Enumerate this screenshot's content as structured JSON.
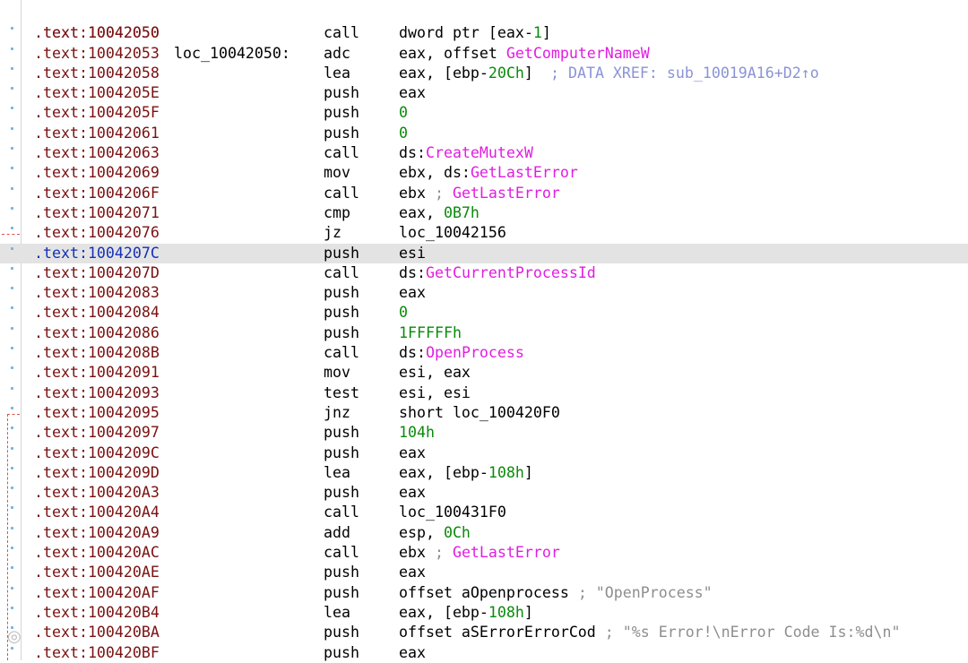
{
  "header": {
    "address": ".text:10042050",
    "label": "loc_10042050:",
    "xref": "; DATA XREF: sub_10019A16+D2↑o"
  },
  "rows": [
    {
      "address": ".text:10042050",
      "mnemonic": "call",
      "operands": [
        {
          "t": "dword ptr [eax-",
          "k": "plain"
        },
        {
          "t": "1",
          "k": "num"
        },
        {
          "t": "]",
          "k": "plain"
        }
      ]
    },
    {
      "address": ".text:10042053",
      "mnemonic": "adc",
      "operands": [
        {
          "t": "eax, offset ",
          "k": "plain"
        },
        {
          "t": "GetComputerNameW",
          "k": "api"
        }
      ]
    },
    {
      "address": ".text:10042058",
      "mnemonic": "lea",
      "operands": [
        {
          "t": "eax, [ebp-",
          "k": "plain"
        },
        {
          "t": "20Ch",
          "k": "num"
        },
        {
          "t": "]",
          "k": "plain"
        }
      ]
    },
    {
      "address": ".text:1004205E",
      "mnemonic": "push",
      "operands": [
        {
          "t": "eax",
          "k": "plain"
        }
      ]
    },
    {
      "address": ".text:1004205F",
      "mnemonic": "push",
      "operands": [
        {
          "t": "0",
          "k": "num"
        }
      ]
    },
    {
      "address": ".text:10042061",
      "mnemonic": "push",
      "operands": [
        {
          "t": "0",
          "k": "num"
        }
      ]
    },
    {
      "address": ".text:10042063",
      "mnemonic": "call",
      "operands": [
        {
          "t": "ds:",
          "k": "plain"
        },
        {
          "t": "CreateMutexW",
          "k": "api"
        }
      ]
    },
    {
      "address": ".text:10042069",
      "mnemonic": "mov",
      "operands": [
        {
          "t": "ebx, ds:",
          "k": "plain"
        },
        {
          "t": "GetLastError",
          "k": "api"
        }
      ]
    },
    {
      "address": ".text:1004206F",
      "mnemonic": "call",
      "operands": [
        {
          "t": "ebx ",
          "k": "plain"
        },
        {
          "t": "; ",
          "k": "comment"
        },
        {
          "t": "GetLastError",
          "k": "api"
        }
      ]
    },
    {
      "address": ".text:10042071",
      "mnemonic": "cmp",
      "operands": [
        {
          "t": "eax, ",
          "k": "plain"
        },
        {
          "t": "0B7h",
          "k": "num"
        }
      ]
    },
    {
      "address": ".text:10042076",
      "mnemonic": "jz",
      "operands": [
        {
          "t": "loc_10042156",
          "k": "plain"
        }
      ]
    },
    {
      "address": ".text:1004207C",
      "mnemonic": "push",
      "operands": [
        {
          "t": "esi",
          "k": "plain"
        }
      ],
      "highlight": true
    },
    {
      "address": ".text:1004207D",
      "mnemonic": "call",
      "operands": [
        {
          "t": "ds:",
          "k": "plain"
        },
        {
          "t": "GetCurrentProcessId",
          "k": "api"
        }
      ]
    },
    {
      "address": ".text:10042083",
      "mnemonic": "push",
      "operands": [
        {
          "t": "eax",
          "k": "plain"
        }
      ]
    },
    {
      "address": ".text:10042084",
      "mnemonic": "push",
      "operands": [
        {
          "t": "0",
          "k": "num"
        }
      ]
    },
    {
      "address": ".text:10042086",
      "mnemonic": "push",
      "operands": [
        {
          "t": "1FFFFFh",
          "k": "num"
        }
      ]
    },
    {
      "address": ".text:1004208B",
      "mnemonic": "call",
      "operands": [
        {
          "t": "ds:",
          "k": "plain"
        },
        {
          "t": "OpenProcess",
          "k": "api"
        }
      ]
    },
    {
      "address": ".text:10042091",
      "mnemonic": "mov",
      "operands": [
        {
          "t": "esi, eax",
          "k": "plain"
        }
      ]
    },
    {
      "address": ".text:10042093",
      "mnemonic": "test",
      "operands": [
        {
          "t": "esi, esi",
          "k": "plain"
        }
      ]
    },
    {
      "address": ".text:10042095",
      "mnemonic": "jnz",
      "operands": [
        {
          "t": "short loc_100420F0",
          "k": "plain"
        }
      ]
    },
    {
      "address": ".text:10042097",
      "mnemonic": "push",
      "operands": [
        {
          "t": "104h",
          "k": "num"
        }
      ]
    },
    {
      "address": ".text:1004209C",
      "mnemonic": "push",
      "operands": [
        {
          "t": "eax",
          "k": "plain"
        }
      ]
    },
    {
      "address": ".text:1004209D",
      "mnemonic": "lea",
      "operands": [
        {
          "t": "eax, [ebp-",
          "k": "plain"
        },
        {
          "t": "108h",
          "k": "num"
        },
        {
          "t": "]",
          "k": "plain"
        }
      ]
    },
    {
      "address": ".text:100420A3",
      "mnemonic": "push",
      "operands": [
        {
          "t": "eax",
          "k": "plain"
        }
      ]
    },
    {
      "address": ".text:100420A4",
      "mnemonic": "call",
      "operands": [
        {
          "t": "loc_100431F0",
          "k": "plain"
        }
      ]
    },
    {
      "address": ".text:100420A9",
      "mnemonic": "add",
      "operands": [
        {
          "t": "esp, ",
          "k": "plain"
        },
        {
          "t": "0Ch",
          "k": "num"
        }
      ]
    },
    {
      "address": ".text:100420AC",
      "mnemonic": "call",
      "operands": [
        {
          "t": "ebx ",
          "k": "plain"
        },
        {
          "t": "; ",
          "k": "comment"
        },
        {
          "t": "GetLastError",
          "k": "api"
        }
      ]
    },
    {
      "address": ".text:100420AE",
      "mnemonic": "push",
      "operands": [
        {
          "t": "eax",
          "k": "plain"
        }
      ]
    },
    {
      "address": ".text:100420AF",
      "mnemonic": "push",
      "operands": [
        {
          "t": "offset aOpenprocess ",
          "k": "plain"
        },
        {
          "t": "; \"OpenProcess\"",
          "k": "comment"
        }
      ]
    },
    {
      "address": ".text:100420B4",
      "mnemonic": "lea",
      "operands": [
        {
          "t": "eax, [ebp-",
          "k": "plain"
        },
        {
          "t": "108h",
          "k": "num"
        },
        {
          "t": "]",
          "k": "plain"
        }
      ]
    },
    {
      "address": ".text:100420BA",
      "mnemonic": "push",
      "operands": [
        {
          "t": "offset aSErrorErrorCod ",
          "k": "plain"
        },
        {
          "t": "; \"%s Error!\\nError Code Is:%d\\n\"",
          "k": "comment"
        }
      ]
    },
    {
      "address": ".text:100420BF",
      "mnemonic": "push",
      "operands": [
        {
          "t": "eax",
          "k": "plain"
        }
      ]
    }
  ],
  "colors": {
    "address": "#7a1111",
    "address_highlight": "#1530b8",
    "number": "#0a8a0a",
    "api": "#e01ee0",
    "comment": "#8e8e8e",
    "xref": "#8a93d6",
    "highlight_bg": "#e3e3e3",
    "gutter_dot": "#6fb3e6",
    "jump_arrow": "#e05050"
  },
  "watermark": {
    "icon": "wechat-icon"
  }
}
